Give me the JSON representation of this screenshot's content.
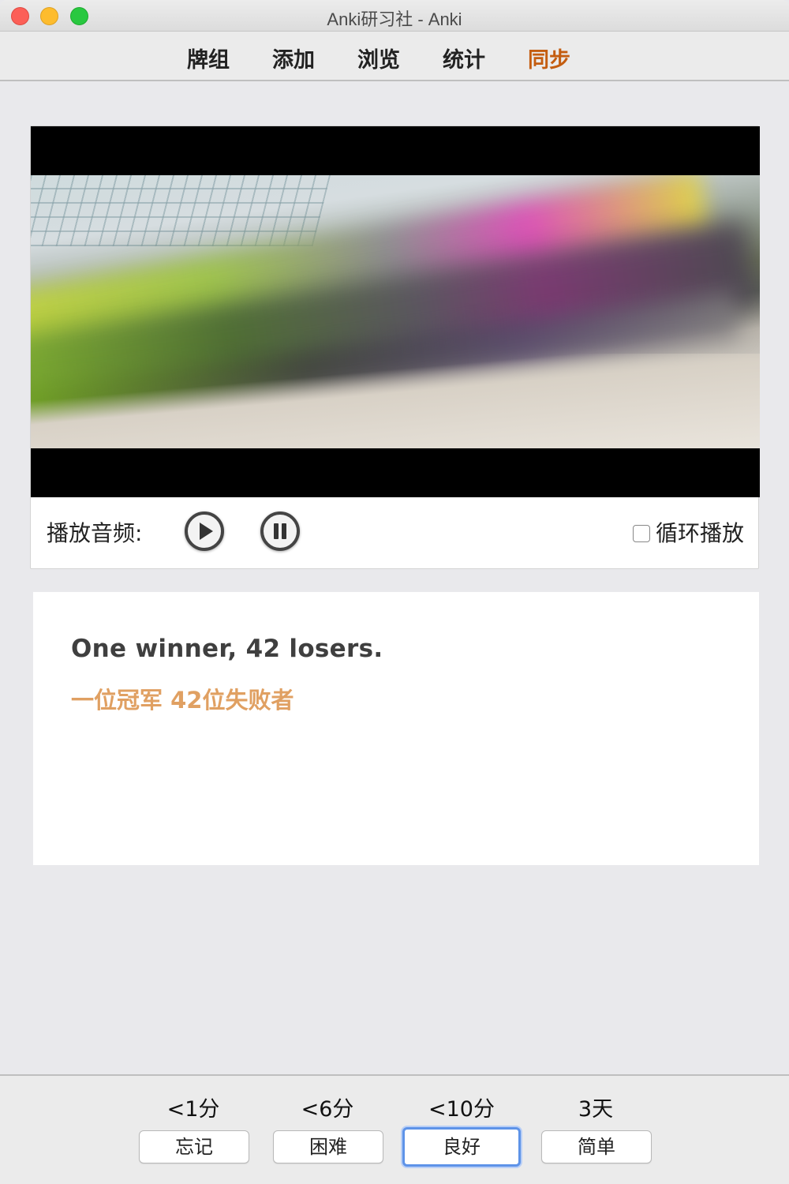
{
  "window": {
    "title": "Anki研习社 - Anki"
  },
  "nav": [
    {
      "label": "牌组"
    },
    {
      "label": "添加"
    },
    {
      "label": "浏览"
    },
    {
      "label": "统计"
    },
    {
      "label": "同步"
    }
  ],
  "nav_active_color": "#c45d10",
  "audio": {
    "label": "播放音频:",
    "play_icon": "play-icon",
    "pause_icon": "pause-icon",
    "loop_label": "循环播放",
    "loop_checked": false
  },
  "card": {
    "english": "One winner, 42 losers.",
    "chinese": "一位冠军 42位失败者",
    "chinese_color": "#e0a062"
  },
  "answers": [
    {
      "due": "<1分",
      "label": "忘记"
    },
    {
      "due": "<6分",
      "label": "困难"
    },
    {
      "due": "<10分",
      "label": "良好"
    },
    {
      "due": "3天",
      "label": "简单"
    }
  ],
  "default_answer_color": "#5e93e8"
}
